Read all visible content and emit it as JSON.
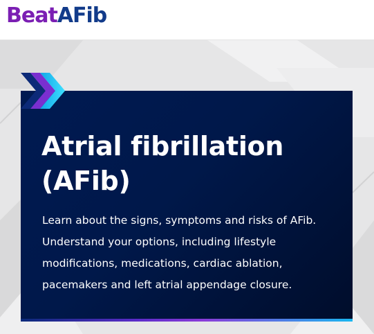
{
  "header": {
    "logo_part1": "Beat",
    "logo_part2": "AFib",
    "logo_colors": {
      "part1": "#7b1fb3",
      "part2": "#123b8a"
    }
  },
  "hero": {
    "title": "Atrial fibrillation (AFib)",
    "description": "Learn about the signs, symptoms and risks of AFib. Understand your options, including lifestyle modifications, medications, cardiac ablation, pacemakers and left atrial appendage closure.",
    "icon": "triple-chevron-right-icon",
    "colors": {
      "card_background": "#001a52",
      "accent_purple": "#8a3bd9",
      "accent_cyan": "#19b7f0",
      "page_background": "#e6e6e7"
    }
  }
}
